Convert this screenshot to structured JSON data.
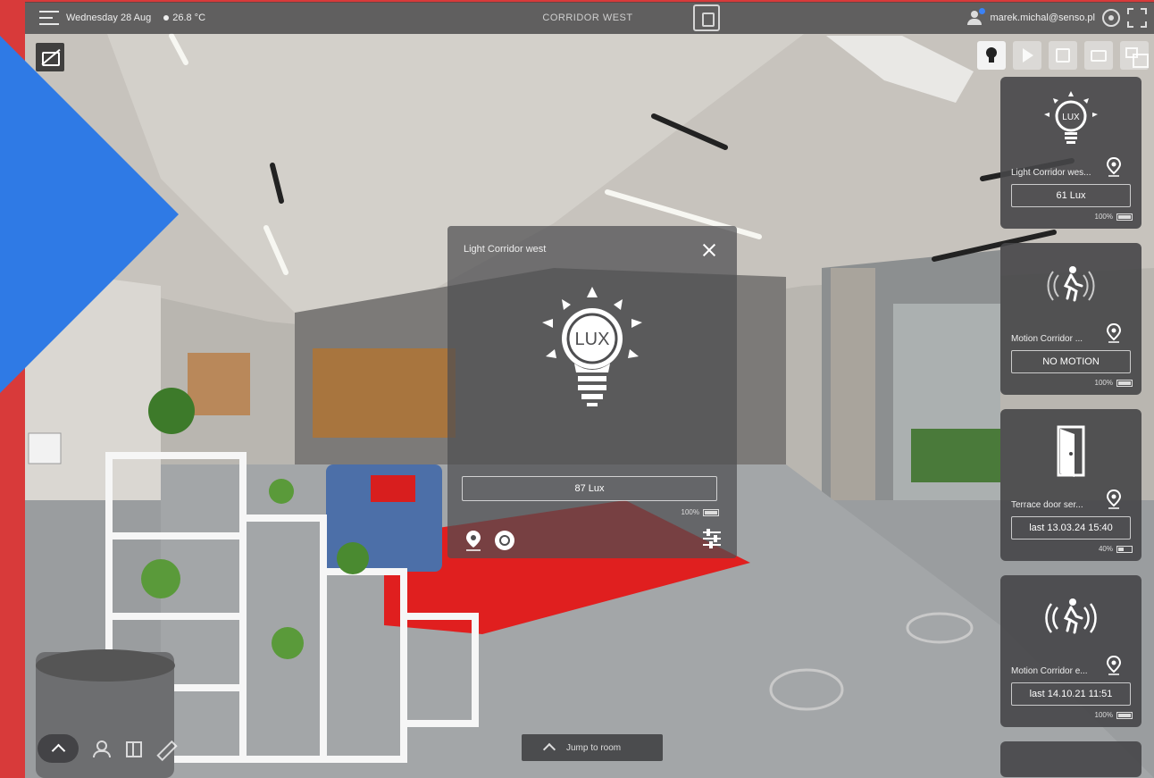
{
  "topbar": {
    "date": "Wednesday 28 Aug",
    "temperature": "26.8 °C",
    "room": "CORRIDOR WEST",
    "user_email": "marek.michal@senso.pl"
  },
  "popup": {
    "title": "Light Corridor west",
    "value": "87 Lux",
    "battery": "100%",
    "icon": "lux-bulb-icon"
  },
  "sensor_cards": [
    {
      "name": "Light Corridor wes...",
      "value": "61 Lux",
      "battery": "100%",
      "battery_level": 1.0,
      "icon": "lux-bulb-icon"
    },
    {
      "name": "Motion Corridor ...",
      "value": "NO MOTION",
      "battery": "100%",
      "battery_level": 1.0,
      "icon": "motion-icon"
    },
    {
      "name": "Terrace door ser...",
      "value": "last 13.03.24 15:40",
      "battery": "40%",
      "battery_level": 0.4,
      "icon": "door-icon"
    },
    {
      "name": "Motion Corridor e...",
      "value": "last 14.10.21 11:51",
      "battery": "100%",
      "battery_level": 1.0,
      "icon": "motion-icon"
    }
  ],
  "bottom": {
    "jump_label": "Jump to room"
  },
  "colors": {
    "accent_red": "#d83a3a",
    "accent_blue": "#2f7ae5",
    "panel": "#464648",
    "carpet_red": "#e01f1f"
  }
}
